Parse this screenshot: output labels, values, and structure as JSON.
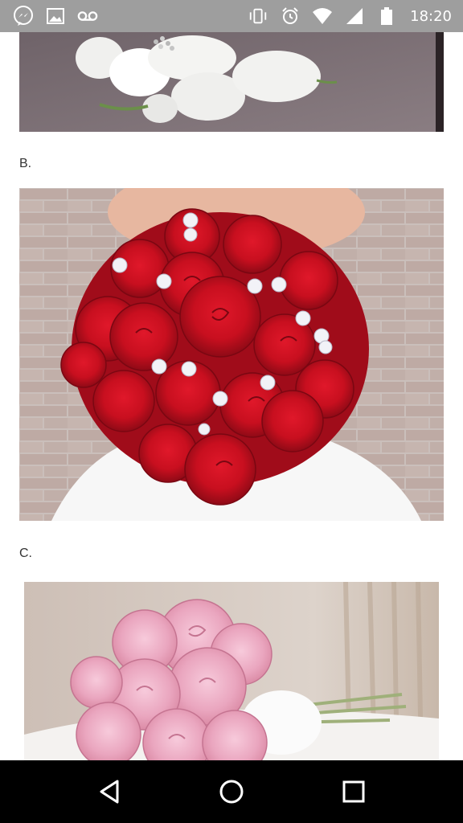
{
  "status_bar": {
    "time": "18:20",
    "left_icons": [
      "messenger-icon",
      "image-icon",
      "voicemail-icon"
    ],
    "right_icons": [
      "vibrate-icon",
      "alarm-icon",
      "wifi-icon",
      "signal-icon",
      "battery-icon"
    ]
  },
  "content": {
    "option_b_label": "B.",
    "option_c_label": "C."
  },
  "nav_bar": {
    "buttons": [
      "back-icon",
      "home-icon",
      "recents-icon"
    ]
  }
}
